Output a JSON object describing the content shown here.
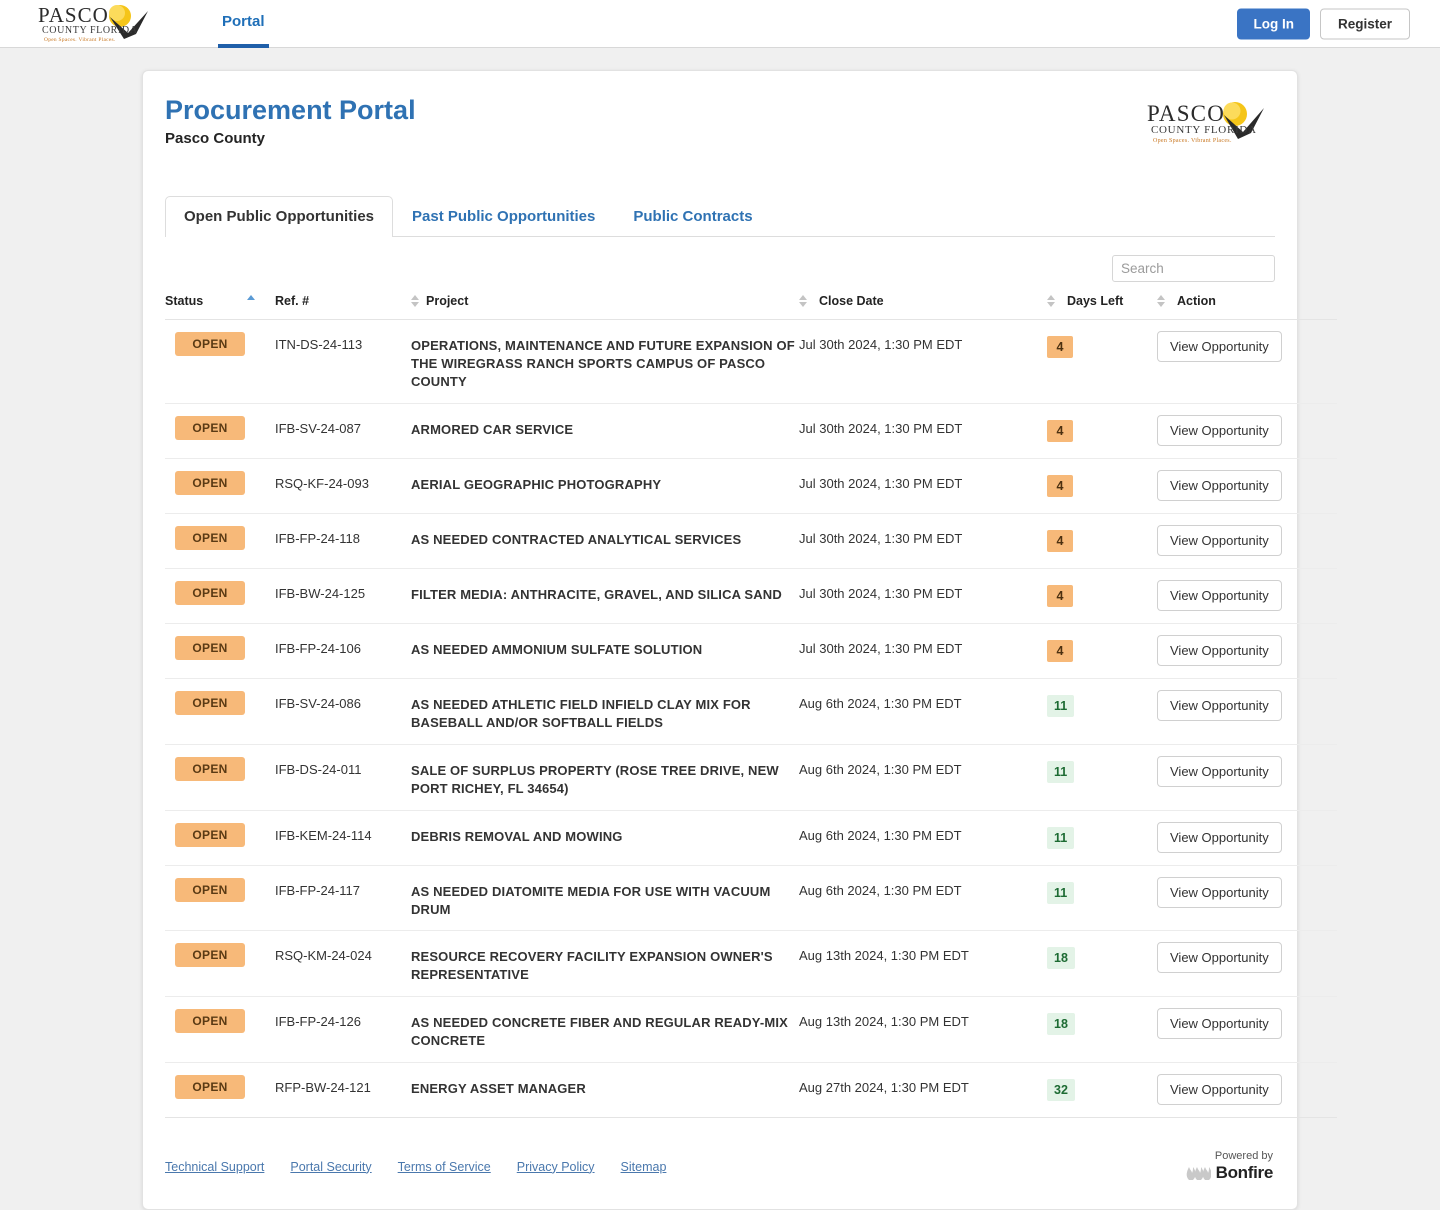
{
  "topbar": {
    "logo_alt": "Pasco County Florida",
    "logo_line1": "PASCO",
    "logo_line2": "COUNTY FLORIDA",
    "logo_tagline": "Open Spaces. Vibrant Places.",
    "nav": [
      {
        "label": "Portal",
        "active": true
      }
    ],
    "login_label": "Log In",
    "register_label": "Register"
  },
  "header": {
    "title": "Procurement Portal",
    "subtitle": "Pasco County"
  },
  "tabs": [
    {
      "label": "Open Public Opportunities",
      "active": true
    },
    {
      "label": "Past Public Opportunities",
      "active": false
    },
    {
      "label": "Public Contracts",
      "active": false
    }
  ],
  "search": {
    "placeholder": "Search",
    "value": ""
  },
  "table": {
    "columns": [
      {
        "key": "status",
        "label": "Status",
        "sort": "asc"
      },
      {
        "key": "ref",
        "label": "Ref. #",
        "sort": "none"
      },
      {
        "key": "project",
        "label": "Project",
        "sort": "none"
      },
      {
        "key": "close_date",
        "label": "Close Date",
        "sort": "none"
      },
      {
        "key": "days_left",
        "label": "Days Left",
        "sort": "none"
      },
      {
        "key": "action",
        "label": "Action",
        "sort": "none"
      }
    ],
    "action_label": "View Opportunity",
    "rows": [
      {
        "status": "OPEN",
        "ref": "ITN-DS-24-113",
        "project": "OPERATIONS, MAINTENANCE AND FUTURE EXPANSION OF THE WIREGRASS RANCH SPORTS CAMPUS OF PASCO COUNTY",
        "close_date": "Jul 30th 2024, 1:30 PM EDT",
        "days_left": "4",
        "days_level": "warn"
      },
      {
        "status": "OPEN",
        "ref": "IFB-SV-24-087",
        "project": "ARMORED CAR SERVICE",
        "close_date": "Jul 30th 2024, 1:30 PM EDT",
        "days_left": "4",
        "days_level": "warn"
      },
      {
        "status": "OPEN",
        "ref": "RSQ-KF-24-093",
        "project": "AERIAL GEOGRAPHIC PHOTOGRAPHY",
        "close_date": "Jul 30th 2024, 1:30 PM EDT",
        "days_left": "4",
        "days_level": "warn"
      },
      {
        "status": "OPEN",
        "ref": "IFB-FP-24-118",
        "project": "AS NEEDED CONTRACTED ANALYTICAL SERVICES",
        "close_date": "Jul 30th 2024, 1:30 PM EDT",
        "days_left": "4",
        "days_level": "warn"
      },
      {
        "status": "OPEN",
        "ref": "IFB-BW-24-125",
        "project": "FILTER MEDIA: ANTHRACITE, GRAVEL, AND SILICA SAND",
        "close_date": "Jul 30th 2024, 1:30 PM EDT",
        "days_left": "4",
        "days_level": "warn"
      },
      {
        "status": "OPEN",
        "ref": "IFB-FP-24-106",
        "project": "AS NEEDED AMMONIUM SULFATE SOLUTION",
        "close_date": "Jul 30th 2024, 1:30 PM EDT",
        "days_left": "4",
        "days_level": "warn"
      },
      {
        "status": "OPEN",
        "ref": "IFB-SV-24-086",
        "project": "AS NEEDED ATHLETIC FIELD INFIELD CLAY MIX FOR BASEBALL AND/OR SOFTBALL FIELDS",
        "close_date": "Aug 6th 2024, 1:30 PM EDT",
        "days_left": "11",
        "days_level": "ok"
      },
      {
        "status": "OPEN",
        "ref": "IFB-DS-24-011",
        "project": "SALE OF SURPLUS PROPERTY (ROSE TREE DRIVE, NEW PORT RICHEY, FL 34654)",
        "close_date": "Aug 6th 2024, 1:30 PM EDT",
        "days_left": "11",
        "days_level": "ok"
      },
      {
        "status": "OPEN",
        "ref": "IFB-KEM-24-114",
        "project": "DEBRIS REMOVAL AND MOWING",
        "close_date": "Aug 6th 2024, 1:30 PM EDT",
        "days_left": "11",
        "days_level": "ok"
      },
      {
        "status": "OPEN",
        "ref": "IFB-FP-24-117",
        "project": "AS NEEDED DIATOMITE MEDIA FOR USE WITH VACUUM DRUM",
        "close_date": "Aug 6th 2024, 1:30 PM EDT",
        "days_left": "11",
        "days_level": "ok"
      },
      {
        "status": "OPEN",
        "ref": "RSQ-KM-24-024",
        "project": "RESOURCE RECOVERY FACILITY EXPANSION OWNER'S REPRESENTATIVE",
        "close_date": "Aug 13th 2024, 1:30 PM EDT",
        "days_left": "18",
        "days_level": "ok"
      },
      {
        "status": "OPEN",
        "ref": "IFB-FP-24-126",
        "project": "AS NEEDED CONCRETE FIBER AND REGULAR READY-MIX CONCRETE",
        "close_date": "Aug 13th 2024, 1:30 PM EDT",
        "days_left": "18",
        "days_level": "ok"
      },
      {
        "status": "OPEN",
        "ref": "RFP-BW-24-121",
        "project": "ENERGY ASSET MANAGER",
        "close_date": "Aug 27th 2024, 1:30 PM EDT",
        "days_left": "32",
        "days_level": "ok"
      }
    ]
  },
  "footer": {
    "links": [
      {
        "label": "Technical Support"
      },
      {
        "label": "Portal Security"
      },
      {
        "label": "Terms of Service"
      },
      {
        "label": "Privacy Policy"
      },
      {
        "label": "Sitemap"
      }
    ],
    "powered_by": "Powered by",
    "brand": "Bonfire"
  },
  "colors": {
    "accent_blue": "#2f72b3",
    "login_blue": "#3a74c4",
    "badge_orange": "#f7b979",
    "badge_green_bg": "#e3f3e7",
    "badge_green_text": "#1d6b33"
  }
}
